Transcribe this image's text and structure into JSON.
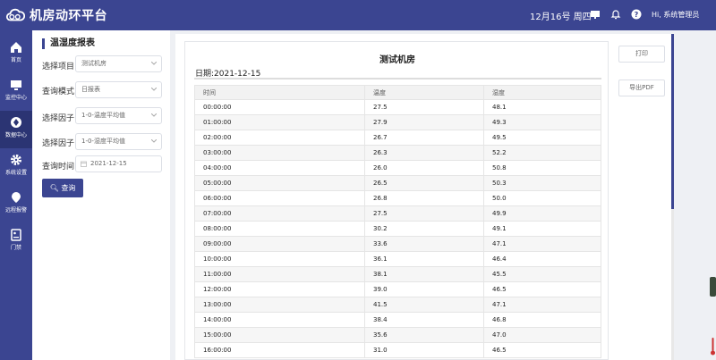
{
  "app": {
    "title": "机房动环平台"
  },
  "header": {
    "date": "12月16号 周四",
    "user": "Hi, 系统管理员"
  },
  "sidebar": {
    "items": [
      {
        "label": "首页",
        "icon": "home-icon"
      },
      {
        "label": "监控中心",
        "icon": "monitor-icon"
      },
      {
        "label": "数据中心",
        "icon": "data-center-icon",
        "active": true
      },
      {
        "label": "系统设置",
        "icon": "gear-icon"
      },
      {
        "label": "远程报警",
        "icon": "alarm-icon"
      },
      {
        "label": "门禁",
        "icon": "access-control-icon"
      }
    ]
  },
  "filter": {
    "section_title": "温湿度报表",
    "project": {
      "label": "选择项目",
      "value": "测试机房"
    },
    "mode": {
      "label": "查询模式",
      "value": "日报表"
    },
    "factor1": {
      "label": "选择因子",
      "value": "1-0-温度平均值"
    },
    "factor2": {
      "label": "选择因子",
      "value": "1-0-湿度平均值"
    },
    "time": {
      "label": "查询时间",
      "value": "2021-12-15"
    },
    "query_button": "查询"
  },
  "report": {
    "title": "测试机房",
    "date_label": "日期:2021-12-15",
    "columns": [
      "时间",
      "温度",
      "湿度"
    ],
    "rows": [
      [
        "00:00:00",
        "27.5",
        "48.1"
      ],
      [
        "01:00:00",
        "27.9",
        "49.3"
      ],
      [
        "02:00:00",
        "26.7",
        "49.5"
      ],
      [
        "03:00:00",
        "26.3",
        "52.2"
      ],
      [
        "04:00:00",
        "26.0",
        "50.8"
      ],
      [
        "05:00:00",
        "26.5",
        "50.3"
      ],
      [
        "06:00:00",
        "26.8",
        "50.0"
      ],
      [
        "07:00:00",
        "27.5",
        "49.9"
      ],
      [
        "08:00:00",
        "30.2",
        "49.1"
      ],
      [
        "09:00:00",
        "33.6",
        "47.1"
      ],
      [
        "10:00:00",
        "36.1",
        "46.4"
      ],
      [
        "11:00:00",
        "38.1",
        "45.5"
      ],
      [
        "12:00:00",
        "39.0",
        "46.5"
      ],
      [
        "13:00:00",
        "41.5",
        "47.1"
      ],
      [
        "14:00:00",
        "38.4",
        "46.8"
      ],
      [
        "15:00:00",
        "35.6",
        "47.0"
      ],
      [
        "16:00:00",
        "31.0",
        "46.5"
      ]
    ]
  },
  "actions": {
    "print": "打印",
    "export_pdf": "导出PDF"
  },
  "colors": {
    "primary": "#3b4591",
    "active_nav": "#2b3473"
  }
}
